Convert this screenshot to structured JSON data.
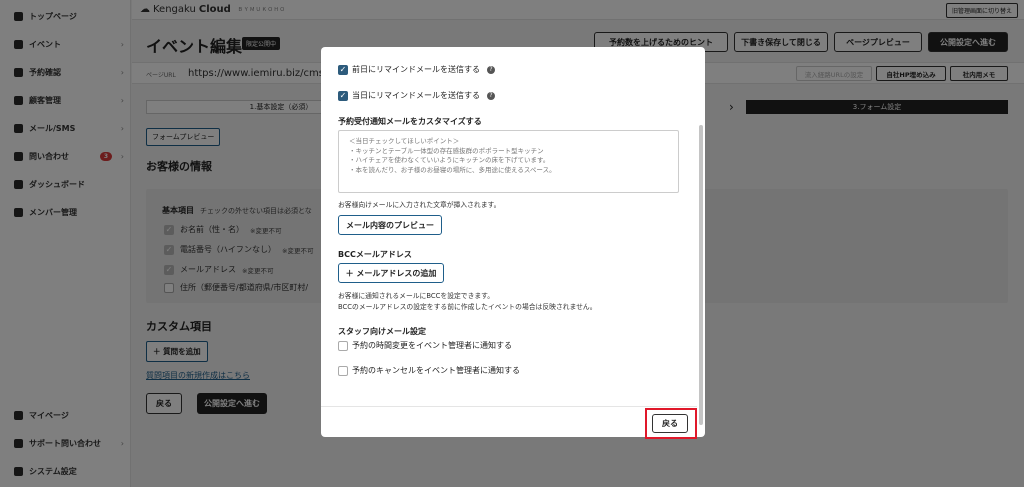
{
  "sidebar": {
    "items": [
      {
        "label": "トップページ",
        "icon": "home-icon"
      },
      {
        "label": "イベント",
        "icon": "document-icon",
        "chevron": "›"
      },
      {
        "label": "予約確認",
        "icon": "calendar-icon",
        "chevron": "›"
      },
      {
        "label": "顧客管理",
        "icon": "users-icon",
        "chevron": "›"
      },
      {
        "label": "メール/SMS",
        "icon": "mail-icon",
        "chevron": "›"
      },
      {
        "label": "問い合わせ",
        "icon": "chat-icon",
        "badge": "3",
        "chevron": "›"
      },
      {
        "label": "ダッシュボード",
        "icon": "chart-icon"
      },
      {
        "label": "メンバー管理",
        "icon": "grid-icon"
      }
    ],
    "bottom_items": [
      {
        "label": "マイページ",
        "icon": "person-icon"
      },
      {
        "label": "サポート問い合わせ",
        "icon": "help-icon",
        "chevron": "›"
      },
      {
        "label": "システム設定",
        "icon": "gear-icon"
      }
    ]
  },
  "topbar": {
    "logo_main": "Kengaku",
    "logo_bold": "Cloud",
    "logo_sub": "ＢＹＭＵＫＯＨＯ",
    "switch_label": "旧管理画面に切り替え"
  },
  "header": {
    "title": "イベント編集",
    "badge": "限定公開中",
    "buttons": {
      "hint": "予約数を上げるためのヒント",
      "draft": "下書き保存して閉じる",
      "preview": "ページプレビュー",
      "publish": "公開設定へ進む"
    }
  },
  "url_row": {
    "label": "ページURL",
    "value": "https://www.iemiru.biz/cms/yo",
    "btn_inflow": "流入経路URLの設定",
    "btn_embed": "自社HP埋め込み",
    "btn_memo": "社内用メモ"
  },
  "steps": {
    "step1": "1.基本設定（必須）",
    "step3": "3.フォーム設定",
    "arrow": "›"
  },
  "form": {
    "preview_btn": "フォームプレビュー",
    "customer_title": "お客様の情報",
    "basic_head": "基本項目",
    "basic_note": "チェックの外せない項目は必須とな",
    "fields": [
      {
        "label": "お名前（性・名）",
        "note": "※変更不可",
        "checked": true
      },
      {
        "label": "電話番号（ハイフンなし）",
        "note": "※変更不可",
        "checked": true
      },
      {
        "label": "メールアドレス",
        "note": "※変更不可",
        "checked": true
      },
      {
        "label": "住所（郵便番号/都道府県/市区町村/",
        "note": "",
        "checked": false
      }
    ],
    "custom_title": "カスタム項目",
    "add_question": "＋ 質問を追加",
    "new_link": "質問項目の新規作成はこちら",
    "back": "戻る",
    "publish": "公開設定へ進む"
  },
  "modal": {
    "remind_prev": "前日にリマインドメールを送信する",
    "remind_today": "当日にリマインドメールを送信する",
    "customize_title": "予約受付通知メールをカスタマイズする",
    "textarea_placeholder": "＜当日チェックしてほしいポイント＞\n・キッチンとテーブル一体型の存在感抜群のポポラート型キッチン\n・ハイチェアを使わなくていいようにキッチンの床を下げています。\n・本を読んだり、お子様のお昼寝の場所に、多用途に使えるスペース。",
    "customize_note": "お客様向けメールに入力された文章が挿入されます。",
    "mail_preview_btn": "メール内容のプレビュー",
    "bcc_title": "BCCメールアドレス",
    "bcc_add_btn": "＋ メールアドレスの追加",
    "bcc_note1": "お客様に通知されるメールにBCCを設定できます。",
    "bcc_note2": "BCCのメールアドレスの設定をする前に作成したイベントの場合は反映されません。",
    "staff_title": "スタッフ向けメール設定",
    "staff_opt1": "予約の時間変更をイベント管理者に通知する",
    "staff_opt2": "予約のキャンセルをイベント管理者に通知する",
    "back": "戻る",
    "check_mark": "✓",
    "help_mark": "?"
  },
  "colors": {
    "accent": "#2d5b7c",
    "highlight": "#e0182a",
    "badge": "#d93a3a"
  }
}
